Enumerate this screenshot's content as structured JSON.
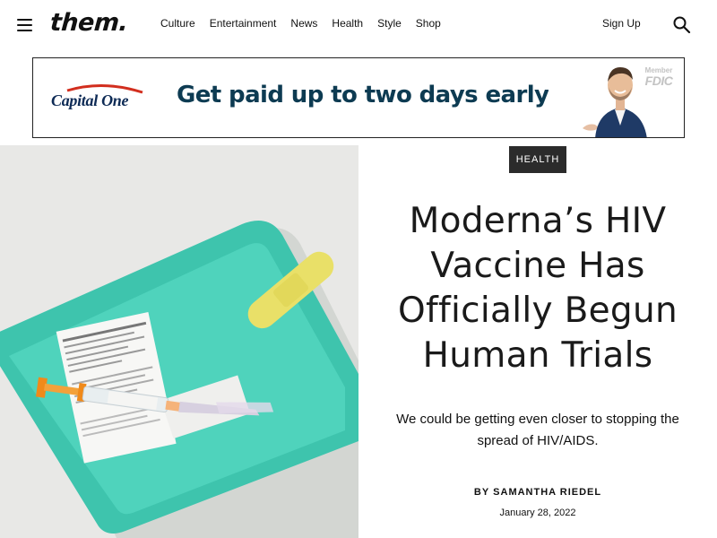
{
  "header": {
    "logo": "them.",
    "nav": [
      "Culture",
      "Entertainment",
      "News",
      "Health",
      "Style",
      "Shop"
    ],
    "signup_label": "Sign Up",
    "menu_icon": "hamburger-menu-icon",
    "search_icon": "search-icon"
  },
  "ad": {
    "brand": "Capital One",
    "headline": "Get paid up to two days early.",
    "fdic_member": "Member",
    "fdic": "FDIC",
    "headline_color": "#0d3b52",
    "brand_color": "#0d2a55",
    "swoosh_color": "#d22e1e"
  },
  "article": {
    "category": "HEALTH",
    "title": "Moderna’s HIV Vaccine Has Officially Begun Human Trials",
    "dek": "We could be getting even closer to stopping the spread of HIV/AIDS.",
    "byline_prefix": "BY",
    "author": "SAMANTHA RIEDEL",
    "date": "January 28, 2022"
  },
  "hero_image": {
    "description_icon": "vaccine-tray-photo"
  },
  "colors": {
    "tag_bg": "#2b2b2b",
    "text": "#111111",
    "tray": "#3ec4ad"
  }
}
